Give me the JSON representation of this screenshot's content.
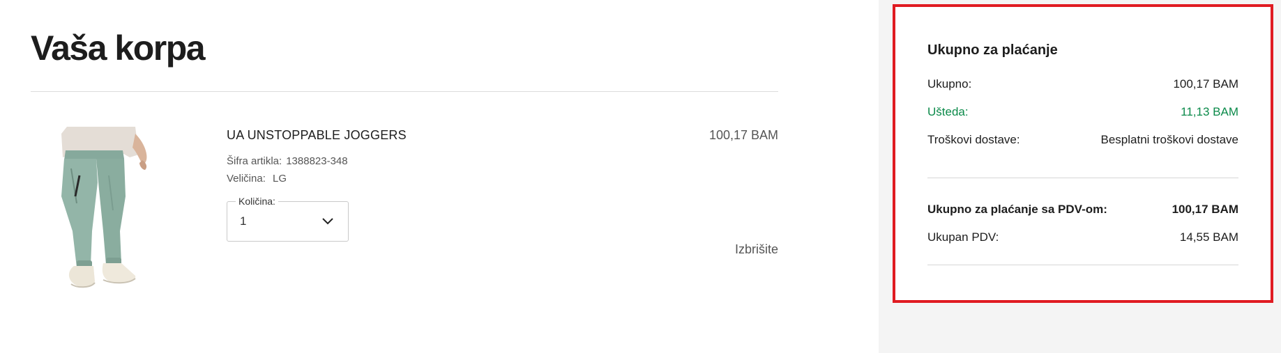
{
  "cart": {
    "title": "Vaša korpa",
    "item": {
      "name": "UA UNSTOPPABLE JOGGERS",
      "sku_label": "Šifra artikla:",
      "sku_value": "1388823-348",
      "size_label": "Veličina:",
      "size_value": "LG",
      "qty_label": "Količina:",
      "qty_value": "1",
      "price": "100,17 BAM",
      "delete_label": "Izbrišite",
      "image_icon": "product-jogger-pants-image"
    }
  },
  "summary": {
    "title": "Ukupno za plaćanje",
    "subtotal_label": "Ukupno:",
    "subtotal_value": "100,17 BAM",
    "savings_label": "Ušteda:",
    "savings_value": "11,13 BAM",
    "shipping_label": "Troškovi dostave:",
    "shipping_value": "Besplatni troškovi dostave",
    "total_label": "Ukupno za plaćanje sa PDV-om:",
    "total_value": "100,17 BAM",
    "vat_label": "Ukupan PDV:",
    "vat_value": "14,55 BAM"
  },
  "colors": {
    "savings_green": "#0b8a4a",
    "highlight_border": "#e01b22",
    "aside_background": "#f4f4f4"
  }
}
